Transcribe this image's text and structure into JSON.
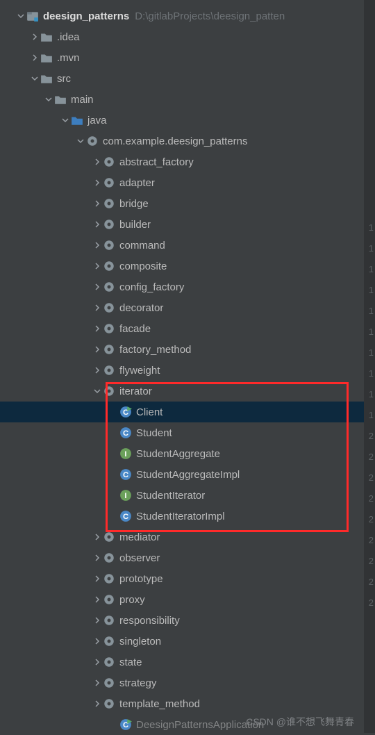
{
  "root": {
    "name": "deesign_patterns",
    "path": "D:\\gitlabProjects\\deesign_patten"
  },
  "watermark": "CSDN @谁不想飞舞青春",
  "gutter_numbers": [
    "1",
    "1",
    "1",
    "1",
    "1",
    "1",
    "1",
    "1",
    "1",
    "1",
    "2",
    "2",
    "2",
    "2",
    "2",
    "2",
    "2",
    "2",
    "2"
  ],
  "tree": [
    {
      "indent": 0,
      "arrow": "down",
      "icon": "module",
      "label": "deesign_patterns",
      "bold": true,
      "extra": "D:\\gitlabProjects\\deesign_patten",
      "labelClass": "light"
    },
    {
      "indent": 1,
      "arrow": "right",
      "icon": "folder",
      "label": ".idea"
    },
    {
      "indent": 1,
      "arrow": "right",
      "icon": "folder",
      "label": ".mvn"
    },
    {
      "indent": 1,
      "arrow": "down",
      "icon": "folder",
      "label": "src"
    },
    {
      "indent": 2,
      "arrow": "down",
      "icon": "folder",
      "label": "main"
    },
    {
      "indent": 3,
      "arrow": "down",
      "icon": "folder-src",
      "label": "java"
    },
    {
      "indent": 4,
      "arrow": "down",
      "icon": "package",
      "label": "com.example.deesign_patterns"
    },
    {
      "indent": 5,
      "arrow": "right",
      "icon": "package",
      "label": "abstract_factory"
    },
    {
      "indent": 5,
      "arrow": "right",
      "icon": "package",
      "label": "adapter"
    },
    {
      "indent": 5,
      "arrow": "right",
      "icon": "package",
      "label": "bridge"
    },
    {
      "indent": 5,
      "arrow": "right",
      "icon": "package",
      "label": "builder"
    },
    {
      "indent": 5,
      "arrow": "right",
      "icon": "package",
      "label": "command"
    },
    {
      "indent": 5,
      "arrow": "right",
      "icon": "package",
      "label": "composite"
    },
    {
      "indent": 5,
      "arrow": "right",
      "icon": "package",
      "label": "config_factory"
    },
    {
      "indent": 5,
      "arrow": "right",
      "icon": "package",
      "label": "decorator"
    },
    {
      "indent": 5,
      "arrow": "right",
      "icon": "package",
      "label": "facade"
    },
    {
      "indent": 5,
      "arrow": "right",
      "icon": "package",
      "label": "factory_method"
    },
    {
      "indent": 5,
      "arrow": "right",
      "icon": "package",
      "label": "flyweight"
    },
    {
      "indent": 5,
      "arrow": "down",
      "icon": "package",
      "label": "iterator"
    },
    {
      "indent": 6,
      "arrow": "none",
      "icon": "class-run",
      "label": "Client",
      "selected": true
    },
    {
      "indent": 6,
      "arrow": "none",
      "icon": "class",
      "label": "Student"
    },
    {
      "indent": 6,
      "arrow": "none",
      "icon": "interface",
      "label": "StudentAggregate"
    },
    {
      "indent": 6,
      "arrow": "none",
      "icon": "class",
      "label": "StudentAggregateImpl"
    },
    {
      "indent": 6,
      "arrow": "none",
      "icon": "interface",
      "label": "StudentIterator"
    },
    {
      "indent": 6,
      "arrow": "none",
      "icon": "class",
      "label": "StudentIteratorImpl"
    },
    {
      "indent": 5,
      "arrow": "right",
      "icon": "package",
      "label": "mediator"
    },
    {
      "indent": 5,
      "arrow": "right",
      "icon": "package",
      "label": "observer"
    },
    {
      "indent": 5,
      "arrow": "right",
      "icon": "package",
      "label": "prototype"
    },
    {
      "indent": 5,
      "arrow": "right",
      "icon": "package",
      "label": "proxy"
    },
    {
      "indent": 5,
      "arrow": "right",
      "icon": "package",
      "label": "responsibility"
    },
    {
      "indent": 5,
      "arrow": "right",
      "icon": "package",
      "label": "singleton"
    },
    {
      "indent": 5,
      "arrow": "right",
      "icon": "package",
      "label": "state"
    },
    {
      "indent": 5,
      "arrow": "right",
      "icon": "package",
      "label": "strategy"
    },
    {
      "indent": 5,
      "arrow": "right",
      "icon": "package",
      "label": "template_method"
    },
    {
      "indent": 6,
      "arrow": "none",
      "icon": "class-run",
      "label": "DeesignPatternsApplication",
      "faded": true
    }
  ]
}
